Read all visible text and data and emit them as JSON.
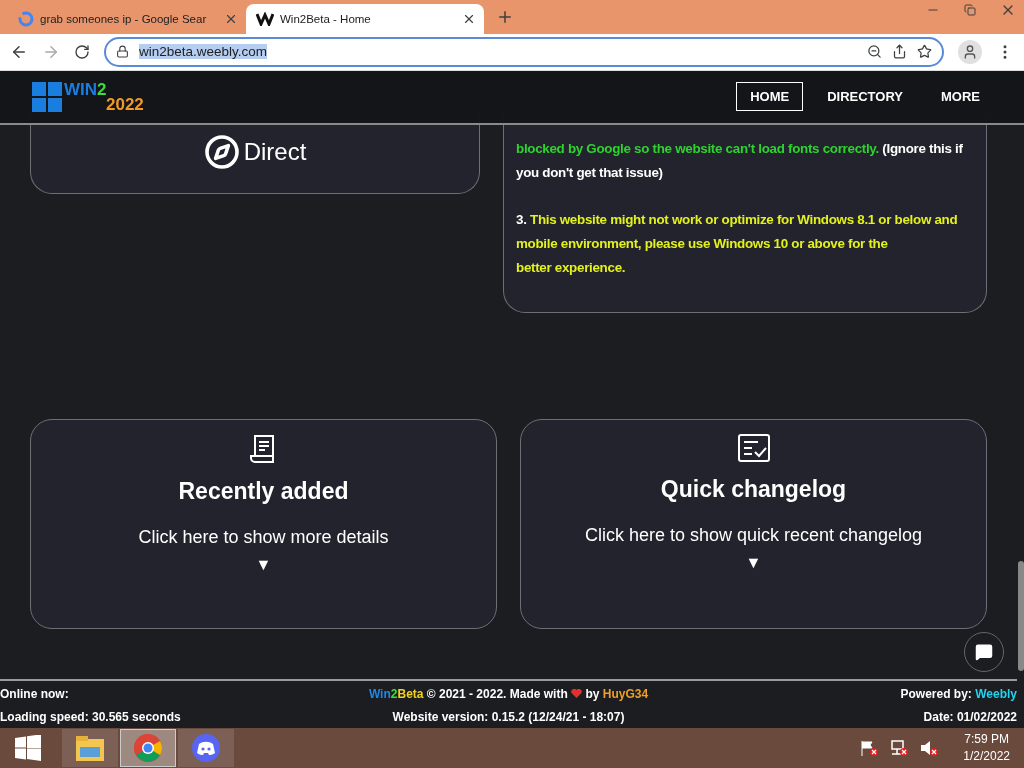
{
  "browser": {
    "tabs": [
      {
        "title": "grab someones ip - Google Sear",
        "kind": "google",
        "selected": false
      },
      {
        "title": "Win2Beta - Home",
        "kind": "weebly",
        "selected": true
      }
    ],
    "url": "win2beta.weebly.com",
    "url_selected": true
  },
  "site": {
    "logo": {
      "word": "WIN",
      "digit": "2",
      "year": "2022"
    },
    "nav": [
      {
        "label": "HOME",
        "selected": true
      },
      {
        "label": "DIRECTORY",
        "selected": false
      },
      {
        "label": "MORE",
        "selected": false
      }
    ],
    "direct_card": {
      "label": "Direct"
    },
    "notes": [
      {
        "lines": [
          [
            {
              "text": "blocked by Google so the website can't load fonts correctly.",
              "color": "#2fd32f"
            },
            {
              "text": " (Ignore this if",
              "color": "#ffffff"
            }
          ],
          [
            {
              "text": "you don't get that issue)",
              "color": "#ffffff"
            }
          ]
        ]
      },
      {
        "lines": [
          [
            {
              "text": "3. ",
              "color": "#ffffff"
            },
            {
              "text": "This website might not work or optimize for Windows 8.1 or below and",
              "color": "#e3f21c"
            }
          ],
          [
            {
              "text": "mobile environment, please use Windows 10 or above for the",
              "color": "#e3f21c"
            }
          ],
          [
            {
              "text": "better experience.",
              "color": "#e3f21c"
            }
          ]
        ]
      }
    ],
    "cards": [
      {
        "kind": "receipt",
        "title": "Recently added",
        "subtitle": "Click here to show more details",
        "arrow": "▼"
      },
      {
        "kind": "checklist",
        "title": "Quick changelog",
        "subtitle": "Click here to show quick recent changelog",
        "arrow": "▼"
      }
    ],
    "footer": {
      "online": "Online now:",
      "loading": "Loading speed: 30.565 seconds",
      "credit_before": [
        {
          "text": "Win",
          "color": "#1e88e5"
        },
        {
          "text": "2",
          "color": "#3ddc3d"
        },
        {
          "text": "Beta",
          "color": "#f2d21c"
        },
        {
          "text": " © 2021 - 2022. Made with ",
          "color": "#ffffff"
        }
      ],
      "credit_after": [
        {
          "text": " by ",
          "color": "#ffffff"
        },
        {
          "text": "HuyG34",
          "color": "#f0a020"
        }
      ],
      "version": "Website version: 0.15.2 (12/24/21 - 18:07)",
      "powered_label": "Powered by: ",
      "powered_name": "Weebly",
      "date": "Date: 01/02/2022"
    }
  },
  "taskbar": {
    "apps": [
      {
        "kind": "explorer",
        "active": false
      },
      {
        "kind": "chrome",
        "active": true
      },
      {
        "kind": "discord",
        "active": false
      }
    ],
    "time": "7:59 PM",
    "date": "1/2/2022"
  }
}
